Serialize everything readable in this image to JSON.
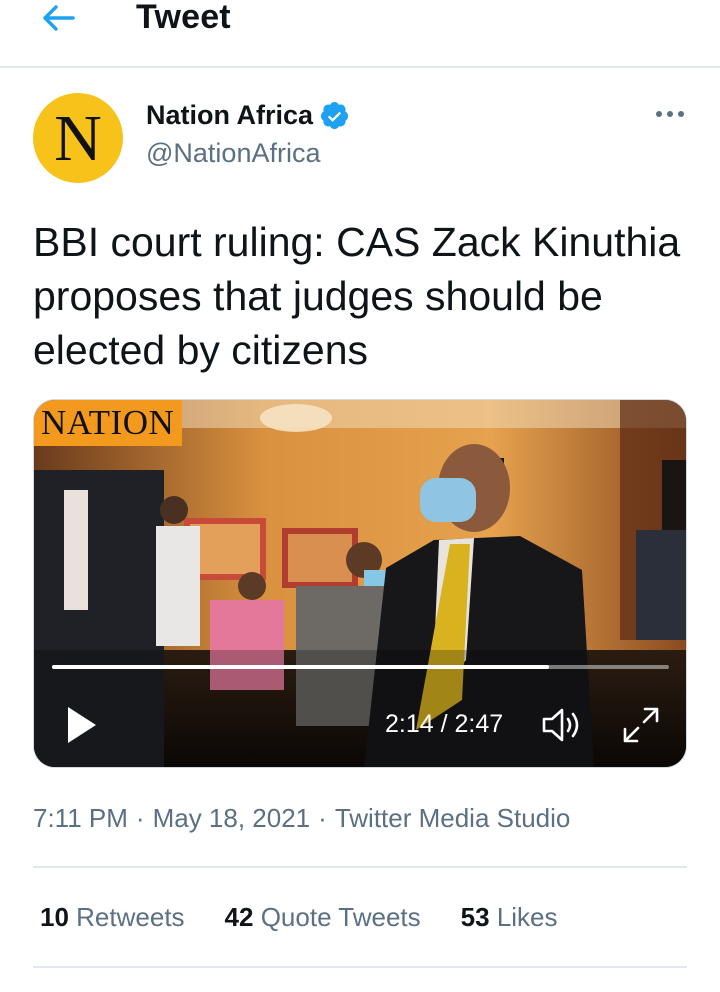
{
  "header": {
    "title": "Tweet",
    "back_icon": "arrow-left-icon"
  },
  "author": {
    "avatar_letter": "N",
    "display_name": "Nation Africa",
    "handle": "@NationAfrica",
    "verified_icon": "verified-badge-icon"
  },
  "tweet": {
    "text": "BBI court ruling: CAS Zack Kinuthia proposes that judges should be elected by citizens"
  },
  "video": {
    "logo_text": "NATION",
    "time": "2:14 / 2:47",
    "progress_fraction": 0.805,
    "play_icon": "play-icon",
    "volume_icon": "volume-icon",
    "fullscreen_icon": "fullscreen-icon"
  },
  "meta": {
    "time": "7:11 PM",
    "separator": "·",
    "date": "May 18, 2021",
    "source": "Twitter Media Studio"
  },
  "stats": {
    "retweets_count": "10",
    "retweets_label": "Retweets",
    "quotes_count": "42",
    "quotes_label": "Quote Tweets",
    "likes_count": "53",
    "likes_label": "Likes"
  },
  "colors": {
    "accent": "#1da1f2",
    "secondary_text": "#5b7083",
    "avatar_bg": "#f7c21a",
    "logo_bg": "#f39a1e"
  }
}
